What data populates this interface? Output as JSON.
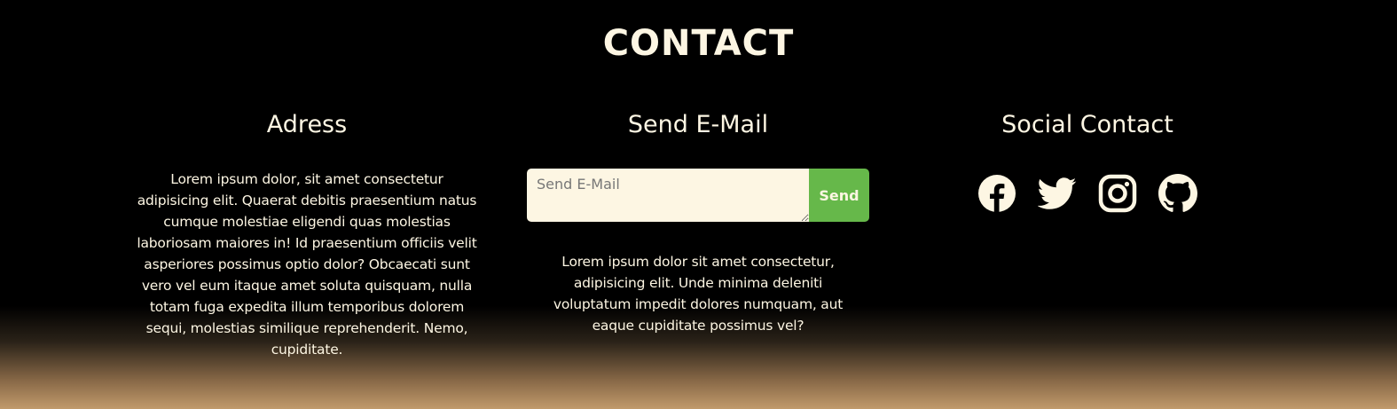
{
  "page_title": "CONTACT",
  "address": {
    "heading": "Adress",
    "text": "Lorem ipsum dolor, sit amet consectetur adipisicing elit. Quaerat debitis praesentium natus cumque molestiae eligendi quas molestias laboriosam maiores in! Id praesentium officiis velit asperiores possimus optio dolor? Obcaecati sunt vero vel eum itaque amet soluta quisquam, nulla totam fuga expedita illum temporibus dolorem sequi, molestias similique reprehenderit. Nemo, cupiditate."
  },
  "email": {
    "heading": "Send E-Mail",
    "input_placeholder": "Send E-Mail",
    "input_value": "",
    "send_label": "Send",
    "text": "Lorem ipsum dolor sit amet consectetur, adipisicing elit. Unde minima deleniti voluptatum impedit dolores numquam, aut eaque cupiditate possimus vel?"
  },
  "social": {
    "heading": "Social Contact",
    "icons": [
      "facebook-icon",
      "twitter-icon",
      "instagram-icon",
      "github-icon"
    ]
  },
  "colors": {
    "background": "#000000",
    "text": "#fdf6e3",
    "accent_green": "#66b84a",
    "gradient_bottom": "#c19a6b"
  }
}
